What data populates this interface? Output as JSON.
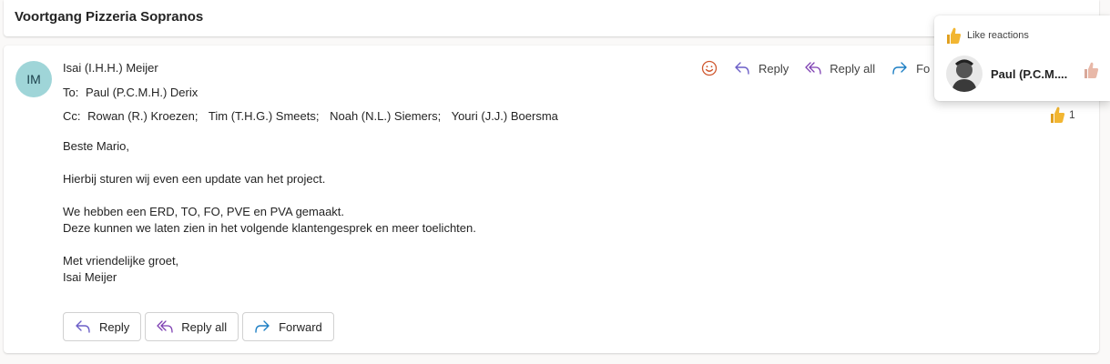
{
  "email": {
    "subject": "Voortgang Pizzeria Sopranos",
    "avatar_initials": "IM",
    "from": "Isai (I.H.H.) Meijer",
    "to_label": "To:",
    "to": "Paul (P.C.M.H.) Derix",
    "cc_label": "Cc:",
    "cc": [
      "Rowan (R.) Kroezen;",
      "Tim (T.H.G.) Smeets;",
      "Noah (N.L.) Siemers;",
      "Youri (J.J.) Boersma"
    ],
    "body": {
      "greeting": "Beste Mario,",
      "line1": "Hierbij sturen wij even een update van het project.",
      "line2": "We hebben een ERD, TO, FO, PVE en PVA gemaakt.",
      "line3": "Deze kunnen we laten zien in het volgende klantengesprek en meer toelichten.",
      "closing": "Met vriendelijke groet,",
      "signature": "Isai Meijer"
    }
  },
  "actions": {
    "reply": "Reply",
    "reply_all": "Reply all",
    "forward_partial": "Fo"
  },
  "bottom_actions": {
    "reply": "Reply",
    "reply_all": "Reply all",
    "forward": "Forward"
  },
  "reaction": {
    "count": "1"
  },
  "popover": {
    "title": "Like reactions",
    "person": "Paul (P.C.M...."
  },
  "colors": {
    "accent_reply": "#6c5fc7",
    "accent_reply_all": "#7e3fb2",
    "accent_forward": "#1d7fc4",
    "avatar_bg": "#9fd5d8",
    "thumb": "#f2b632"
  }
}
